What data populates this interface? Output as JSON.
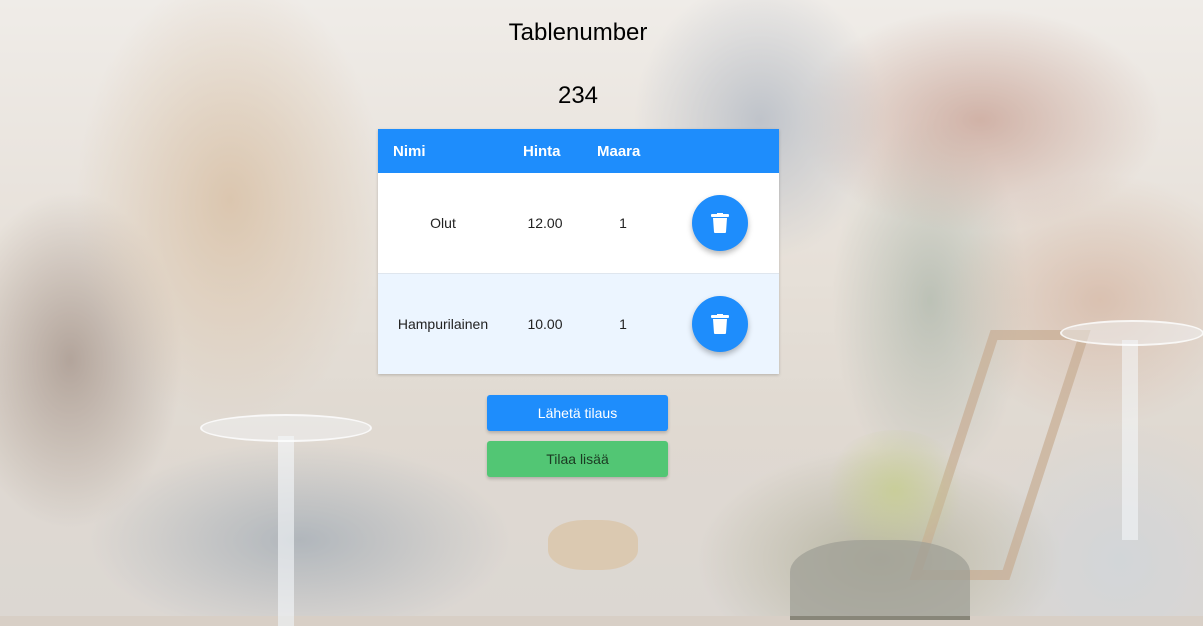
{
  "page": {
    "title": "Tablenumber",
    "table_number": "234"
  },
  "table": {
    "headers": {
      "name": "Nimi",
      "price": "Hinta",
      "quantity": "Maara"
    },
    "rows": [
      {
        "name": "Olut",
        "price": "12.00",
        "quantity": "1",
        "delete_icon": "trash-icon"
      },
      {
        "name": "Hampurilainen",
        "price": "10.00",
        "quantity": "1",
        "delete_icon": "trash-icon"
      }
    ]
  },
  "buttons": {
    "send_label": "Lähetä tilaus",
    "order_more_label": "Tilaa lisää"
  },
  "colors": {
    "primary": "#1e8dfc",
    "success": "#52c674",
    "row_alt": "#ecf5ff"
  }
}
